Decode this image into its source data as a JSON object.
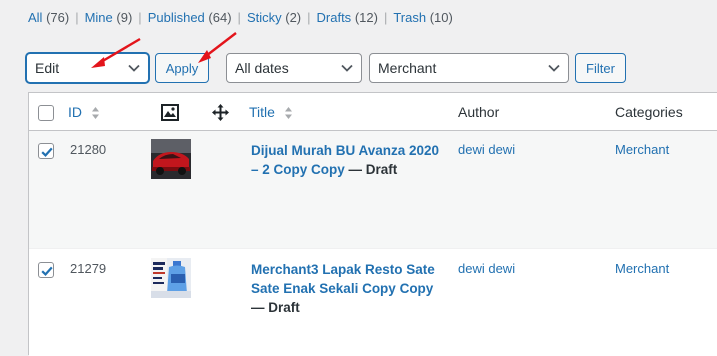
{
  "views": [
    {
      "label": "All",
      "count": "(76)"
    },
    {
      "label": "Mine",
      "count": "(9)"
    },
    {
      "label": "Published",
      "count": "(64)"
    },
    {
      "label": "Sticky",
      "count": "(2)"
    },
    {
      "label": "Drafts",
      "count": "(12)"
    },
    {
      "label": "Trash",
      "count": "(10)"
    }
  ],
  "view_separator": "|",
  "toolbar": {
    "bulk_action": "Edit",
    "apply_label": "Apply",
    "dates_filter": "All dates",
    "category_filter": "Merchant",
    "filter_label": "Filter"
  },
  "columns": {
    "id": "ID",
    "thumbnail_icon": "image-icon",
    "move_icon": "move-arrows-icon",
    "title": "Title",
    "author": "Author",
    "categories": "Categories"
  },
  "rows": [
    {
      "checked": true,
      "id": "21280",
      "title": "Dijual Murah BU Avanza 2020 – 2 Copy Copy",
      "state": "— Draft",
      "author": "dewi dewi",
      "category": "Merchant",
      "thumb": "red-car-photo"
    },
    {
      "checked": true,
      "id": "21279",
      "title": "Merchant3 Lapak Resto Sate Sate Enak Sekali Copy Copy",
      "state": "— Draft",
      "author": "dewi dewi",
      "category": "Merchant",
      "thumb": "water-gallon-promo"
    }
  ],
  "colors": {
    "link": "#2271b1",
    "annotation_arrow": "#e3141b"
  }
}
